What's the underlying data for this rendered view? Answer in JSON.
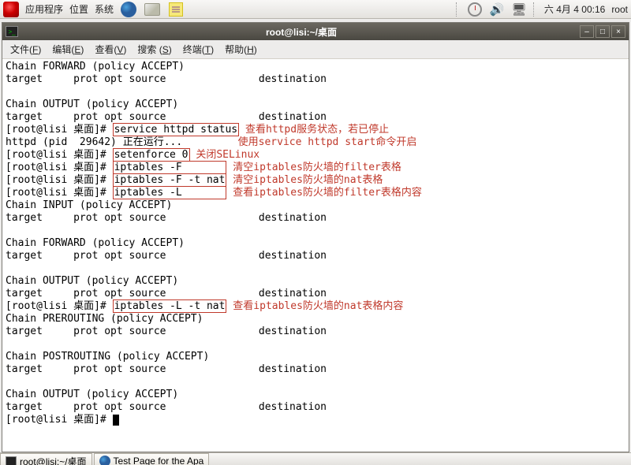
{
  "panel": {
    "menu_apps": "应用程序",
    "menu_places": "位置",
    "menu_system": "系统",
    "datetime": "六 4月  4 00:16",
    "user": "root"
  },
  "window": {
    "title": "root@lisi:~/桌面",
    "menus": {
      "file": "文件(",
      "file_u": "F",
      "file2": ")",
      "edit": "编辑(",
      "edit_u": "E",
      "edit2": ")",
      "view": "查看(",
      "view_u": "V",
      "view2": ")",
      "search": "搜索 (",
      "search_u": "S",
      "search2": ")",
      "terminal": "终端(",
      "terminal_u": "T",
      "terminal2": ")",
      "help": "帮助(",
      "help_u": "H",
      "help2": ")"
    }
  },
  "term": {
    "l1": "Chain FORWARD (policy ACCEPT)",
    "l2": "target     prot opt source               destination",
    "l3": "",
    "l4": "Chain OUTPUT (policy ACCEPT)",
    "l5": "target     prot opt source               destination",
    "l6p": "[root@lisi 桌面]# ",
    "l6c": "service httpd status",
    "l6a1": "查看httpd服务状态，若已停止",
    "l7": "httpd (pid  29642) 正在运行...",
    "l7a": "使用service httpd start命令开启",
    "l8p": "[root@lisi 桌面]# ",
    "l8c": "setenforce 0",
    "l8a": "关闭SELinux",
    "l9p": "[root@lisi 桌面]# ",
    "l9c": "iptables -F       ",
    "l9a": "清空iptables防火墙的filter表格",
    "l10p": "[root@lisi 桌面]# ",
    "l10c": "iptables -F -t nat",
    "l10a": "清空iptables防火墙的nat表格",
    "l11p": "[root@lisi 桌面]# ",
    "l11c": "iptables -L       ",
    "l11a": "查看iptables防火墙的filter表格内容",
    "l12": "Chain INPUT (policy ACCEPT)",
    "l13": "target     prot opt source               destination",
    "l14": "",
    "l15": "Chain FORWARD (policy ACCEPT)",
    "l16": "target     prot opt source               destination",
    "l17": "",
    "l18": "Chain OUTPUT (policy ACCEPT)",
    "l19": "target     prot opt source               destination",
    "l20p": "[root@lisi 桌面]# ",
    "l20c": "iptables -L -t nat",
    "l20a": "查看iptables防火墙的nat表格内容",
    "l21": "Chain PREROUTING (policy ACCEPT)",
    "l22": "target     prot opt source               destination",
    "l23": "",
    "l24": "Chain POSTROUTING (policy ACCEPT)",
    "l25": "target     prot opt source               destination",
    "l26": "",
    "l27": "Chain OUTPUT (policy ACCEPT)",
    "l28": "target     prot opt source               destination",
    "l29p": "[root@lisi 桌面]# "
  },
  "taskbar": {
    "task1": "root@lisi:~/桌面",
    "task2": "Test Page for the Apa"
  }
}
